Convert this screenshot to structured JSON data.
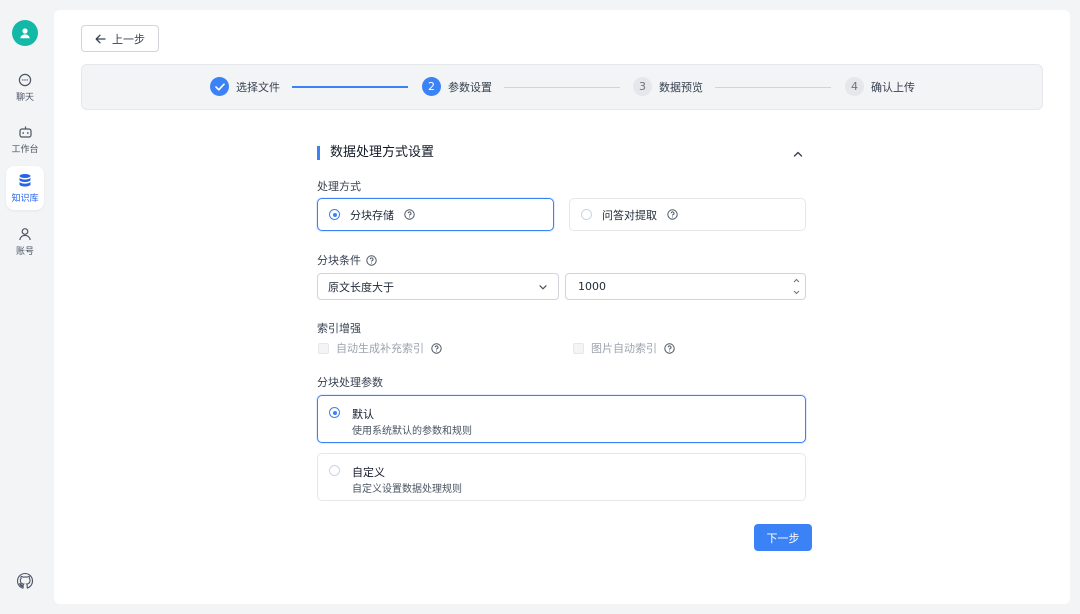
{
  "sidebar": {
    "items": [
      {
        "label": "聊天",
        "icon": "chat-icon"
      },
      {
        "label": "工作台",
        "icon": "robot-icon"
      },
      {
        "label": "知识库",
        "icon": "database-icon"
      },
      {
        "label": "账号",
        "icon": "user-icon"
      }
    ],
    "active_index": 2
  },
  "header": {
    "back_label": "上一步"
  },
  "steps": [
    {
      "number": "1",
      "label": "选择文件",
      "state": "done"
    },
    {
      "number": "2",
      "label": "参数设置",
      "state": "active"
    },
    {
      "number": "3",
      "label": "数据预览",
      "state": "todo"
    },
    {
      "number": "4",
      "label": "确认上传",
      "state": "todo"
    }
  ],
  "form": {
    "section_title": "数据处理方式设置",
    "mode_label": "处理方式",
    "modes": [
      {
        "label": "分块存储",
        "selected": true
      },
      {
        "label": "问答对提取",
        "selected": false
      }
    ],
    "chunk_condition_label": "分块条件",
    "chunk_condition_value": "原文长度大于",
    "chunk_length_value": "1000",
    "index_label": "索引增强",
    "index_options": [
      {
        "label": "自动生成补充索引",
        "checked": false,
        "disabled": true
      },
      {
        "label": "图片自动索引",
        "checked": false,
        "disabled": true
      }
    ],
    "params_label": "分块处理参数",
    "params": [
      {
        "title": "默认",
        "desc": "使用系统默认的参数和规则",
        "selected": true
      },
      {
        "title": "自定义",
        "desc": "自定义设置数据处理规则",
        "selected": false
      }
    ],
    "next_label": "下一步"
  },
  "colors": {
    "accent": "#3b82f6",
    "avatar": "#14b8a6"
  }
}
